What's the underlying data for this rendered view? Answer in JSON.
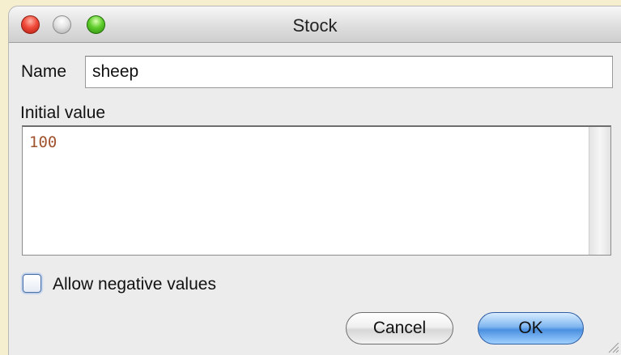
{
  "window": {
    "title": "Stock"
  },
  "form": {
    "name_label": "Name",
    "name_value": "sheep",
    "initial_label": "Initial value",
    "initial_value": "100",
    "checkbox_label": "Allow negative values",
    "checkbox_checked": false
  },
  "buttons": {
    "cancel": "Cancel",
    "ok": "OK"
  },
  "colors": {
    "background": "#f5efcf",
    "window": "#ececec",
    "initial_value_text": "#a0522d",
    "ok_button": "#4a8fe0"
  },
  "icons": {
    "close": "close-icon",
    "minimize": "minimize-icon",
    "zoom": "zoom-icon",
    "resize": "resize-grip-icon"
  }
}
